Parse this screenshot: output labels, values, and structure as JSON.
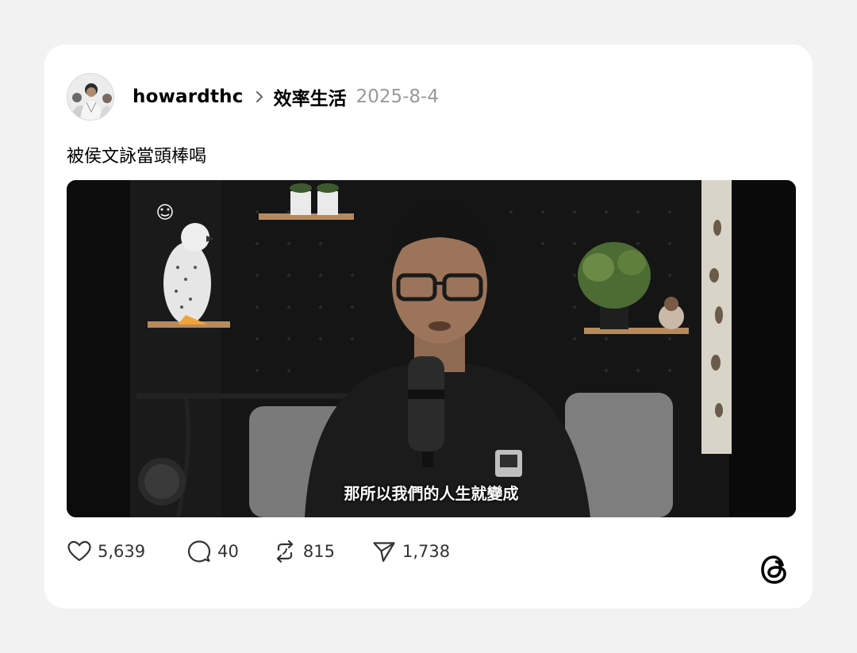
{
  "post": {
    "author": "howardthc",
    "topic": "效率生活",
    "date": "2025-8-4",
    "text": "被侯文詠當頭棒喝",
    "video_subtitle": "那所以我們的人生就變成"
  },
  "actions": {
    "likes": "5,639",
    "replies": "40",
    "reposts": "815",
    "shares": "1,738"
  },
  "icons": {
    "avatar": "profile-photo",
    "chevron": "chevron-right-icon",
    "like": "heart-icon",
    "reply": "speech-bubble-icon",
    "repost": "repost-arrows-icon",
    "share": "paper-plane-icon",
    "brand": "threads-logo"
  },
  "colors": {
    "background": "#f2f2f2",
    "card": "#ffffff",
    "muted_text": "#999999",
    "video_background": "#111111"
  }
}
